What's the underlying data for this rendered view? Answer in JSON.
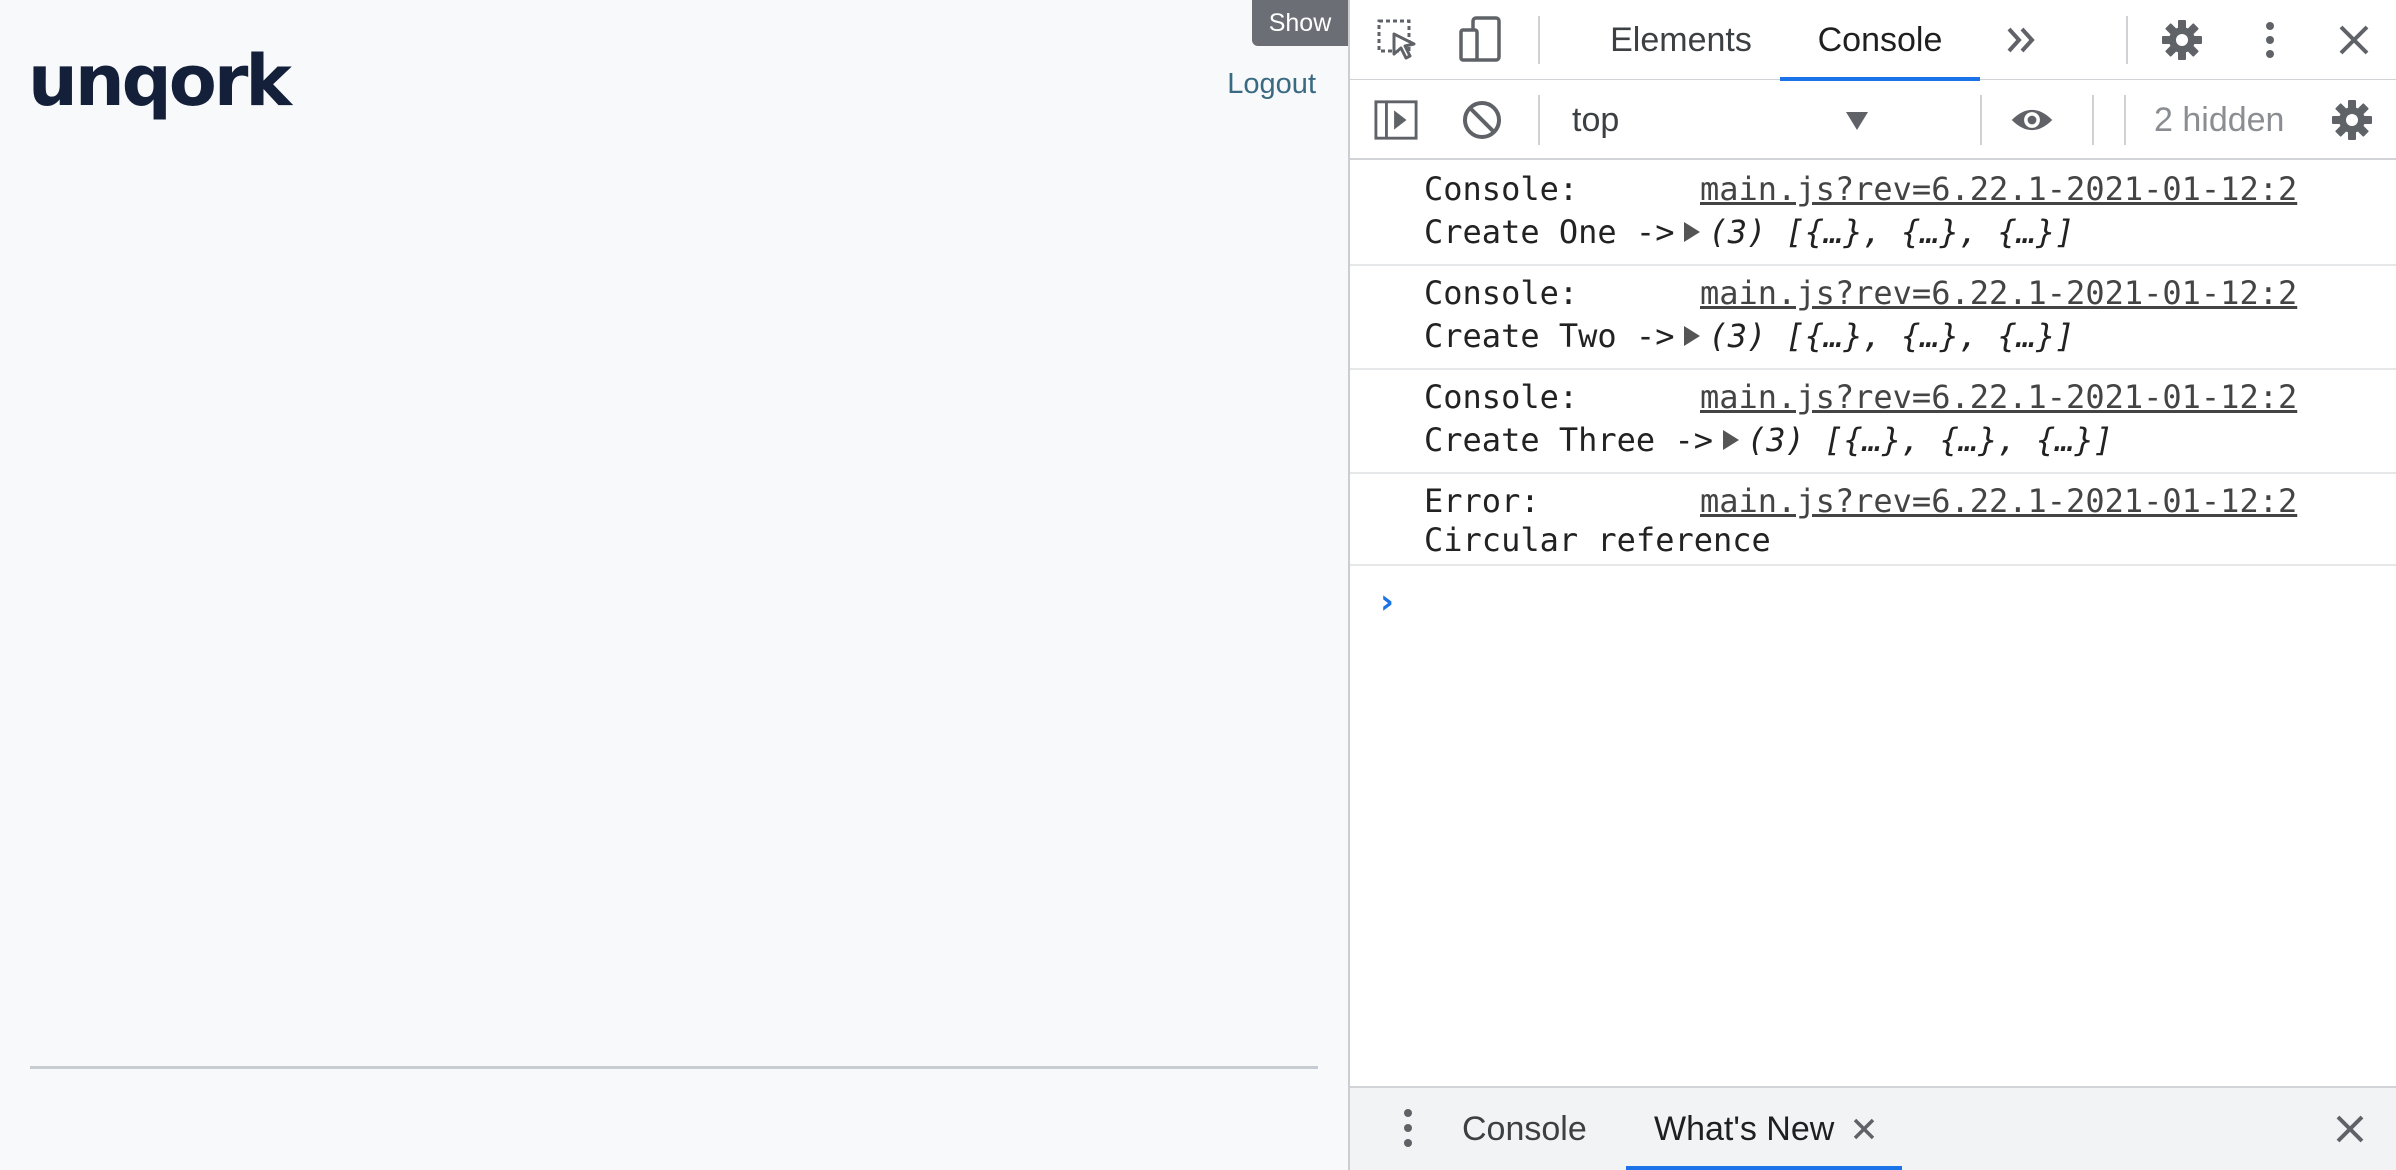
{
  "app": {
    "logo": "unqork",
    "logout": "Logout",
    "show_button": "Show"
  },
  "devtools": {
    "tabs": [
      {
        "label": "Elements"
      },
      {
        "label": "Console"
      }
    ],
    "active_tab": "Console",
    "context": "top",
    "hidden": "2 hidden",
    "messages": [
      {
        "kind": "Console:",
        "source": "main.js?rev=6.22.1-2021-01-12:2",
        "prefix": "Create One ->",
        "value": "(3) [{…}, {…}, {…}]"
      },
      {
        "kind": "Console:",
        "source": "main.js?rev=6.22.1-2021-01-12:2",
        "prefix": "Create Two ->",
        "value": "(3) [{…}, {…}, {…}]"
      },
      {
        "kind": "Console:",
        "source": "main.js?rev=6.22.1-2021-01-12:2",
        "prefix": "Create Three ->",
        "value": "(3) [{…}, {…}, {…}]"
      },
      {
        "kind": "Error:",
        "source": "main.js?rev=6.22.1-2021-01-12:2",
        "prefix": "Circular reference",
        "value": ""
      }
    ],
    "prompt": "›",
    "drawer": {
      "tabs": [
        {
          "label": "Console"
        },
        {
          "label": "What's New"
        }
      ],
      "active_tab": "What's New"
    },
    "icons": [
      "inspect-element-icon",
      "device-toolbar-icon",
      "more-tabs-icon",
      "settings-icon",
      "kebab-menu-icon",
      "close-icon",
      "sidebar-toggle-icon",
      "clear-console-icon",
      "eye-icon",
      "console-settings-icon",
      "drawer-menu-icon",
      "close-tab-icon",
      "close-drawer-icon"
    ],
    "accent_color": "#1a73e8"
  }
}
